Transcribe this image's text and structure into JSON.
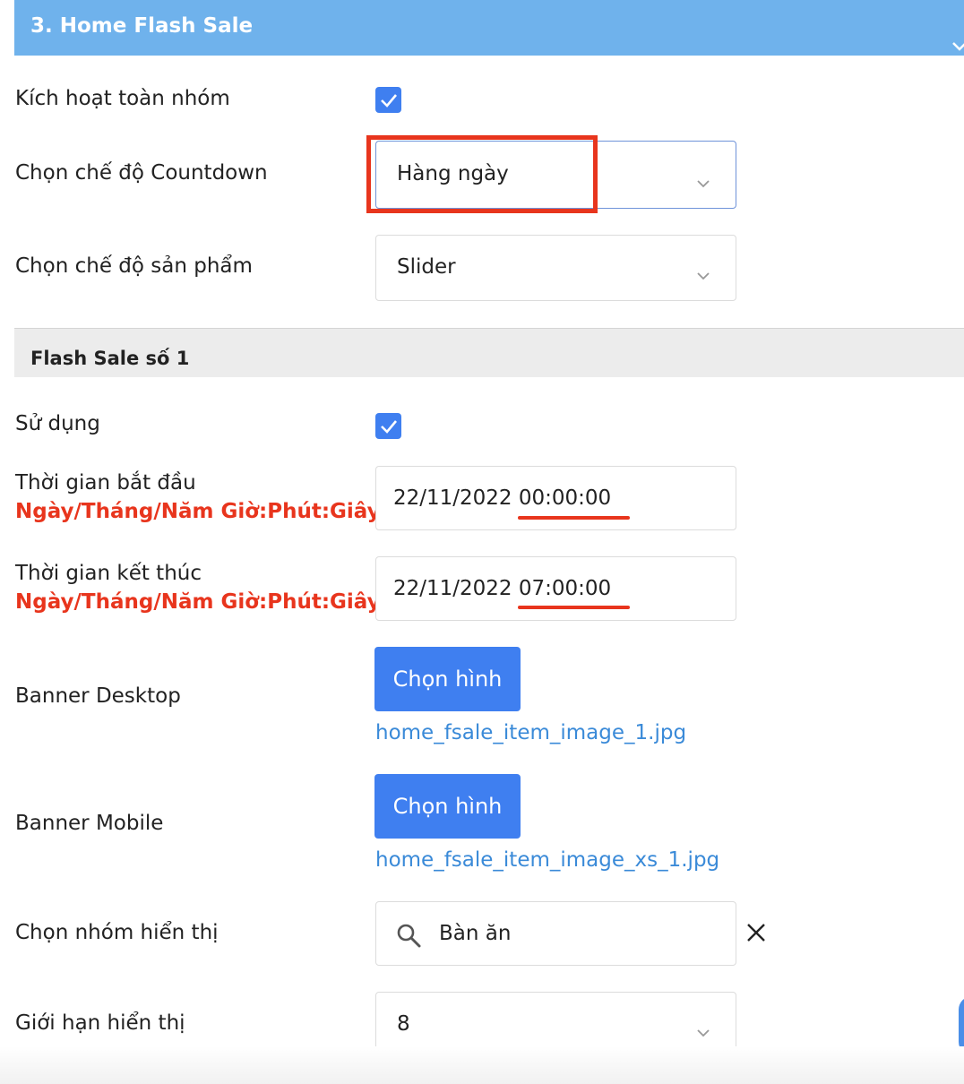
{
  "section": {
    "title": "3. Home Flash Sale"
  },
  "rows": {
    "activate_group": {
      "label": "Kích hoạt toàn nhóm",
      "checked": true
    },
    "countdown_mode": {
      "label": "Chọn chế độ Countdown",
      "value": "Hàng ngày"
    },
    "product_mode": {
      "label": "Chọn chế độ sản phẩm",
      "value": "Slider"
    }
  },
  "flash_sale": {
    "title": "Flash Sale số 1",
    "use": {
      "label": "Sử dụng",
      "checked": true
    },
    "start_time": {
      "label": "Thời gian bắt đầu",
      "hint": "Ngày/Tháng/Năm Giờ:Phút:Giây",
      "value": "22/11/2022 00:00:00"
    },
    "end_time": {
      "label": "Thời gian kết thúc",
      "hint": "Ngày/Tháng/Năm Giờ:Phút:Giây",
      "value": "22/11/2022 07:00:00"
    },
    "banner_desktop": {
      "label": "Banner Desktop",
      "button": "Chọn hình",
      "file": "home_fsale_item_image_1.jpg"
    },
    "banner_mobile": {
      "label": "Banner Mobile",
      "button": "Chọn hình",
      "file": "home_fsale_item_image_xs_1.jpg"
    },
    "display_group": {
      "label": "Chọn nhóm hiển thị",
      "value": "Bàn ăn"
    },
    "display_limit": {
      "label": "Giới hạn hiển thị",
      "value": "8"
    }
  },
  "colors": {
    "header": "#6fb2ec",
    "accent": "#3f7ff0",
    "hint": "#e8351d",
    "link": "#3a8ad8"
  },
  "icons": [
    "chevron-down-icon",
    "check-icon",
    "search-icon",
    "close-icon"
  ]
}
